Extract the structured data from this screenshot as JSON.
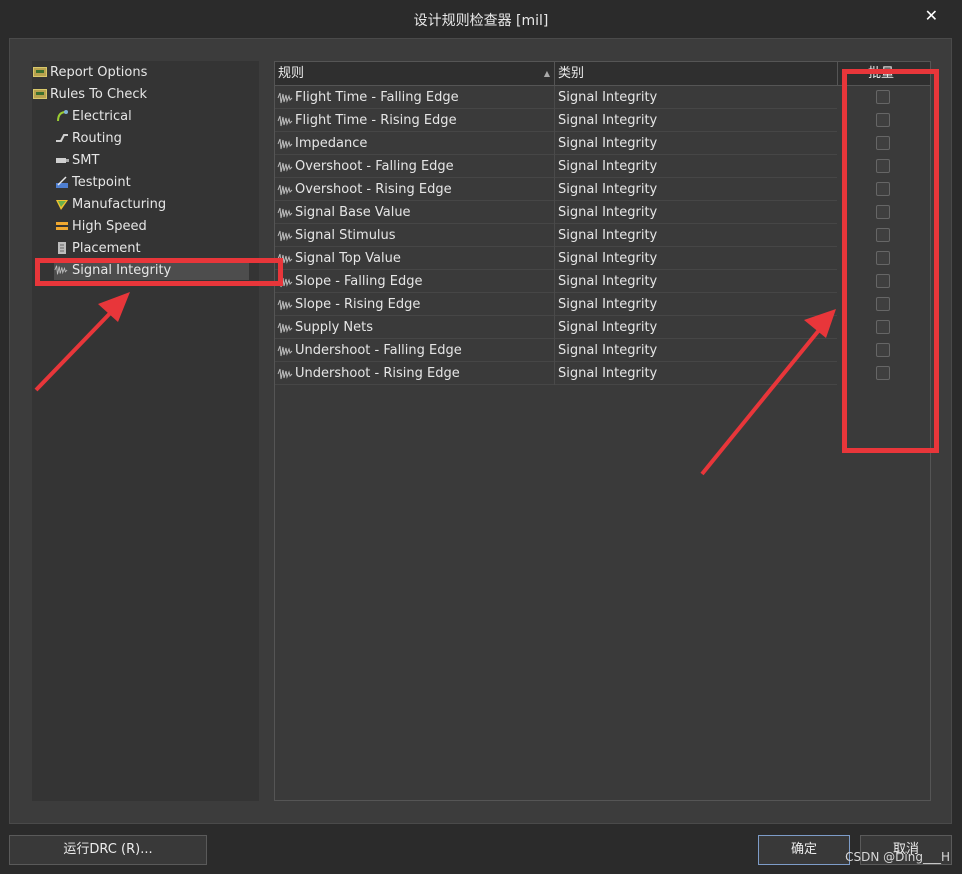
{
  "window": {
    "title": "设计规则检查器 [mil]"
  },
  "tree": {
    "items": [
      {
        "label": "Report Options",
        "icon": "folder-icon",
        "level": 0
      },
      {
        "label": "Rules To Check",
        "icon": "folder-icon",
        "level": 0
      },
      {
        "label": "Electrical",
        "icon": "electrical-icon",
        "level": 1
      },
      {
        "label": "Routing",
        "icon": "routing-icon",
        "level": 1
      },
      {
        "label": "SMT",
        "icon": "smt-icon",
        "level": 1
      },
      {
        "label": "Testpoint",
        "icon": "testpoint-icon",
        "level": 1
      },
      {
        "label": "Manufacturing",
        "icon": "manufacturing-icon",
        "level": 1
      },
      {
        "label": "High Speed",
        "icon": "high-speed-icon",
        "level": 1
      },
      {
        "label": "Placement",
        "icon": "placement-icon",
        "level": 1
      },
      {
        "label": "Signal Integrity",
        "icon": "signal-integrity-icon",
        "level": 1,
        "selected": true
      }
    ]
  },
  "table": {
    "headers": {
      "rule": "规则",
      "category": "类别",
      "batch": "批量"
    },
    "rows": [
      {
        "rule": "Flight Time - Falling Edge",
        "category": "Signal Integrity"
      },
      {
        "rule": "Flight Time - Rising Edge",
        "category": "Signal Integrity"
      },
      {
        "rule": "Impedance",
        "category": "Signal Integrity"
      },
      {
        "rule": "Overshoot - Falling Edge",
        "category": "Signal Integrity"
      },
      {
        "rule": "Overshoot - Rising Edge",
        "category": "Signal Integrity"
      },
      {
        "rule": "Signal Base Value",
        "category": "Signal Integrity"
      },
      {
        "rule": "Signal Stimulus",
        "category": "Signal Integrity"
      },
      {
        "rule": "Signal Top Value",
        "category": "Signal Integrity"
      },
      {
        "rule": "Slope - Falling Edge",
        "category": "Signal Integrity"
      },
      {
        "rule": "Slope - Rising Edge",
        "category": "Signal Integrity"
      },
      {
        "rule": "Supply Nets",
        "category": "Signal Integrity"
      },
      {
        "rule": "Undershoot - Falling Edge",
        "category": "Signal Integrity"
      },
      {
        "rule": "Undershoot - Rising Edge",
        "category": "Signal Integrity"
      }
    ]
  },
  "buttons": {
    "run_drc": "运行DRC (R)...",
    "ok": "确定",
    "cancel": "取消"
  },
  "watermark": "CSDN @Ding___H",
  "colors": {
    "annotation": "#e8363a",
    "background": "#2b2b2b",
    "panel": "#3c3c3c",
    "selection": "#4d4d4d"
  }
}
